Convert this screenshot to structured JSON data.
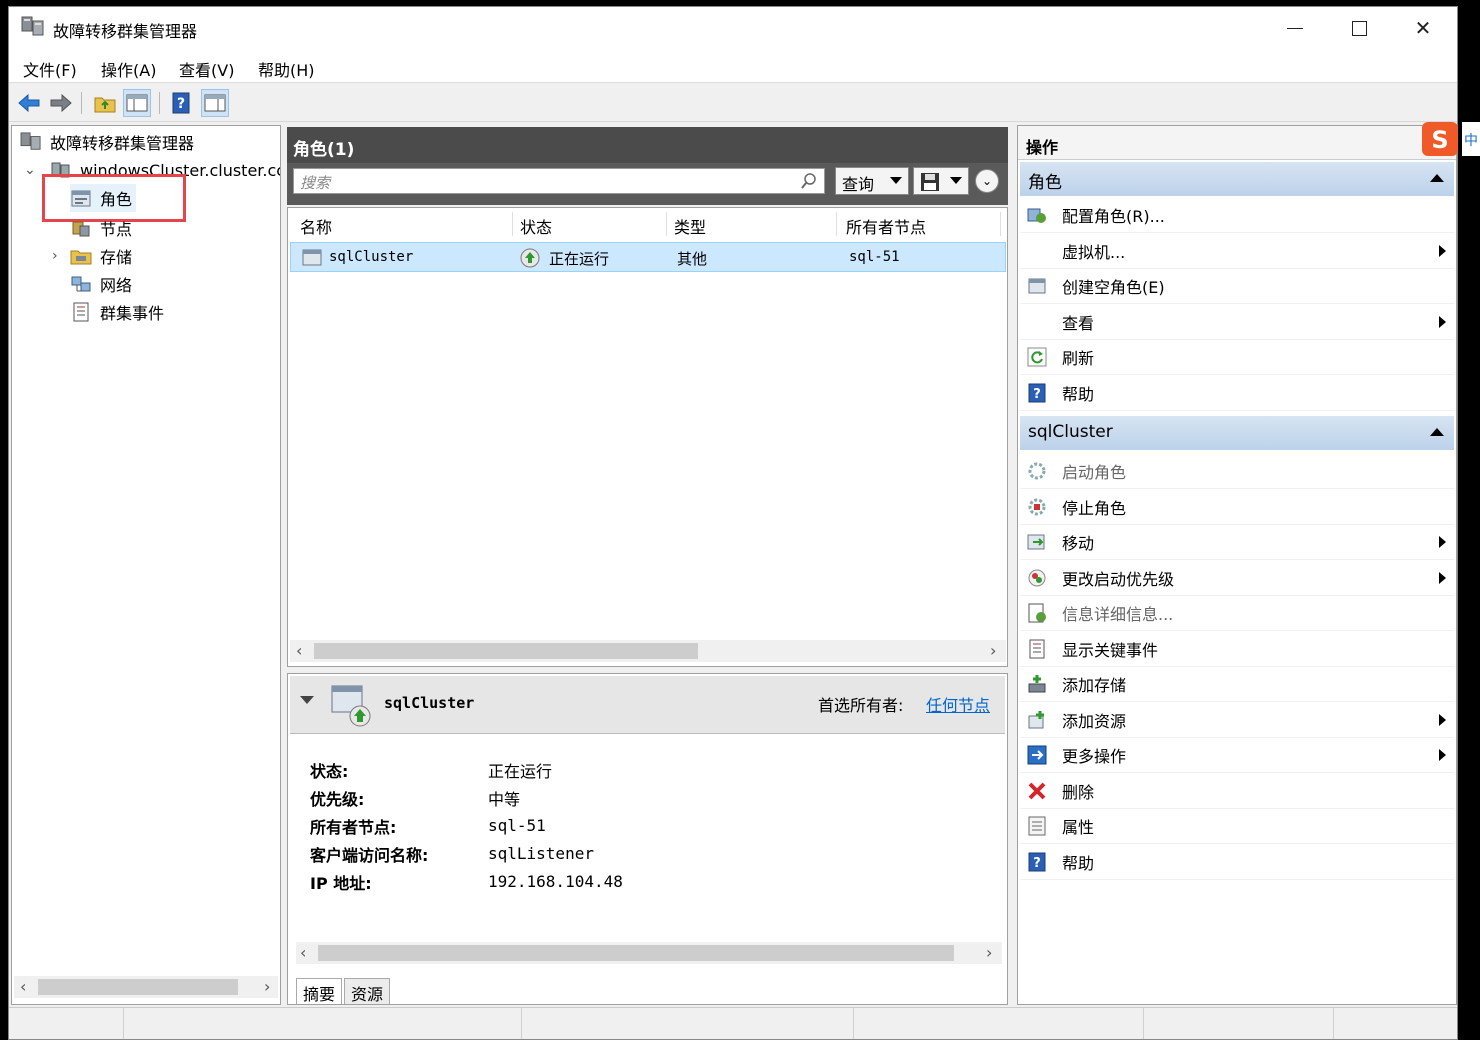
{
  "window": {
    "title": "故障转移群集管理器"
  },
  "menu": [
    "文件(F)",
    "操作(A)",
    "查看(V)",
    "帮助(H)"
  ],
  "tree": {
    "root": "故障转移群集管理器",
    "cluster": "windowsCluster.cluster.cc",
    "items": [
      "角色",
      "节点",
      "存储",
      "网络",
      "群集事件"
    ]
  },
  "roles_pane": {
    "header": "角色(1)",
    "search_placeholder": "搜索",
    "query_label": "查询",
    "columns": [
      "名称",
      "状态",
      "类型",
      "所有者节点"
    ],
    "rows": [
      {
        "name": "sqlCluster",
        "status": "正在运行",
        "type": "其他",
        "owner": "sql-51"
      }
    ]
  },
  "details": {
    "name": "sqlCluster",
    "preferred_owner_label": "首选所有者:",
    "preferred_owner_link": "任何节点",
    "fields": [
      {
        "label": "状态:",
        "value": "正在运行"
      },
      {
        "label": "优先级:",
        "value": "中等"
      },
      {
        "label": "所有者节点:",
        "value": "sql-51"
      },
      {
        "label": "客户端访问名称:",
        "value": "sqlListener"
      },
      {
        "label": "IP 地址:",
        "value": "192.168.104.48"
      }
    ],
    "tabs": [
      "摘要",
      "资源"
    ]
  },
  "actions": {
    "header": "操作",
    "section1": {
      "title": "角色",
      "items": [
        {
          "label": "配置角色(R)...",
          "icon": "configure-role-icon",
          "submenu": false
        },
        {
          "label": "虚拟机...",
          "icon": "",
          "submenu": true
        },
        {
          "label": "创建空角色(E)",
          "icon": "empty-role-icon",
          "submenu": false
        },
        {
          "label": "查看",
          "icon": "",
          "submenu": true
        },
        {
          "label": "刷新",
          "icon": "refresh-icon",
          "submenu": false
        },
        {
          "label": "帮助",
          "icon": "help-icon",
          "submenu": false
        }
      ]
    },
    "section2": {
      "title": "sqlCluster",
      "items": [
        {
          "label": "启动角色",
          "icon": "start-role-icon",
          "submenu": false,
          "disabled": true
        },
        {
          "label": "停止角色",
          "icon": "stop-role-icon",
          "submenu": false
        },
        {
          "label": "移动",
          "icon": "move-icon",
          "submenu": true
        },
        {
          "label": "更改启动优先级",
          "icon": "priority-icon",
          "submenu": true
        },
        {
          "label": "信息详细信息...",
          "icon": "info-details-icon",
          "submenu": false,
          "disabled": true
        },
        {
          "label": "显示关键事件",
          "icon": "critical-events-icon",
          "submenu": false
        },
        {
          "label": "添加存储",
          "icon": "add-storage-icon",
          "submenu": false
        },
        {
          "label": "添加资源",
          "icon": "add-resource-icon",
          "submenu": true
        },
        {
          "label": "更多操作",
          "icon": "more-actions-icon",
          "submenu": true
        },
        {
          "label": "删除",
          "icon": "delete-icon",
          "submenu": false
        },
        {
          "label": "属性",
          "icon": "properties-icon",
          "submenu": false
        },
        {
          "label": "帮助",
          "icon": "help-icon",
          "submenu": false
        }
      ]
    }
  },
  "colors": {
    "selection": "#cce8ff",
    "section_header": "#c8daee",
    "highlight_box": "#e5444a",
    "link": "#0066cc"
  }
}
